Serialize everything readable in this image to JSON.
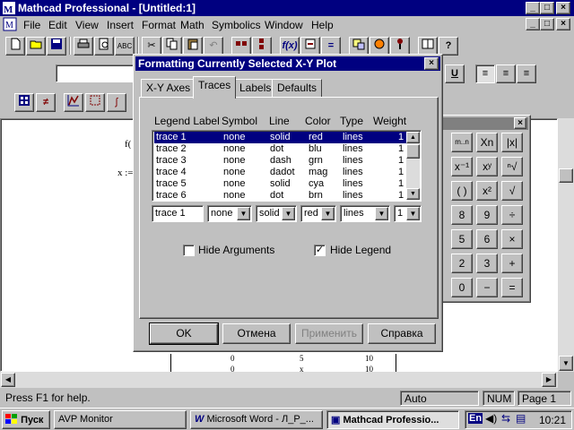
{
  "app": {
    "title": "Mathcad Professional - [Untitled:1]",
    "caption_buttons": [
      "_",
      "□",
      "×"
    ],
    "doc_caption_buttons": [
      "_",
      "□",
      "×"
    ]
  },
  "menu": [
    "File",
    "Edit",
    "View",
    "Insert",
    "Format",
    "Math",
    "Symbolics",
    "Window",
    "Help"
  ],
  "toolbar": {
    "icons": [
      "new-icon",
      "open-icon",
      "save-icon",
      "print-icon",
      "print-preview-icon",
      "spell-check-icon",
      "cut-icon",
      "copy-icon",
      "paste-icon",
      "undo-icon",
      "align-across-icon",
      "align-down-icon",
      "insert-function-icon",
      "insert-unit-icon",
      "calculate-icon",
      "component-icon",
      "copy-region-icon",
      "help-icon",
      "book-icon",
      "question-icon"
    ],
    "format_buttons": [
      "U",
      "≡",
      "≡",
      "≡"
    ],
    "math_palette_icons": [
      "calculator-icon",
      "boolean-icon",
      "graph-icon",
      "matrix-icon",
      "calculus-icon"
    ]
  },
  "document": {
    "fragment_f": "f(",
    "fragment_x": "x :=",
    "table_rows": [
      [
        "0",
        "5",
        "10"
      ],
      [
        "0",
        "x",
        "10"
      ]
    ]
  },
  "palette": {
    "close": "×",
    "buttons": [
      "m..n",
      "Xn",
      "|x|",
      "x⁻¹",
      "xʸ",
      "ⁿ√",
      "( )",
      "x²",
      "√",
      "8",
      "9",
      "÷",
      "5",
      "6",
      "×",
      "2",
      "3",
      "+",
      "0",
      "−",
      "="
    ]
  },
  "dialog": {
    "title": "Formatting Currently Selected X-Y Plot",
    "close": "×",
    "tabs": [
      "X-Y Axes",
      "Traces",
      "Labels",
      "Defaults"
    ],
    "active_tab": "Traces",
    "columns": [
      "Legend Label",
      "Symbol",
      "Line",
      "Color",
      "Type",
      "Weight"
    ],
    "rows": [
      [
        "trace 1",
        "none",
        "solid",
        "red",
        "lines",
        "1"
      ],
      [
        "trace 2",
        "none",
        "dot",
        "blu",
        "lines",
        "1"
      ],
      [
        "trace 3",
        "none",
        "dash",
        "grn",
        "lines",
        "1"
      ],
      [
        "trace 4",
        "none",
        "dadot",
        "mag",
        "lines",
        "1"
      ],
      [
        "trace 5",
        "none",
        "solid",
        "cya",
        "lines",
        "1"
      ],
      [
        "trace 6",
        "none",
        "dot",
        "brn",
        "lines",
        "1"
      ]
    ],
    "edit": {
      "legend": "trace 1",
      "symbol": "none",
      "line": "solid",
      "color": "red",
      "type": "lines",
      "weight": "1"
    },
    "hide_arguments": {
      "label": "Hide Arguments",
      "checked": false
    },
    "hide_legend": {
      "label": "Hide Legend",
      "checked": true
    },
    "buttons": {
      "ok": "OK",
      "cancel": "Отмена",
      "apply": "Применить",
      "help": "Справка"
    }
  },
  "status": {
    "help": "Press F1 for help.",
    "mode": "Auto",
    "num": "NUM",
    "page": "Page 1"
  },
  "taskbar": {
    "start": "Пуск",
    "tasks": [
      "AVP Monitor",
      "Microsoft Word - Л_Р_...",
      "Mathcad Professio..."
    ],
    "lang": "En",
    "clock": "10:21"
  },
  "colors": {
    "titlebar": "#000080",
    "selection": "#000080",
    "desktop": "#008080",
    "face": "#c0c0c0"
  }
}
